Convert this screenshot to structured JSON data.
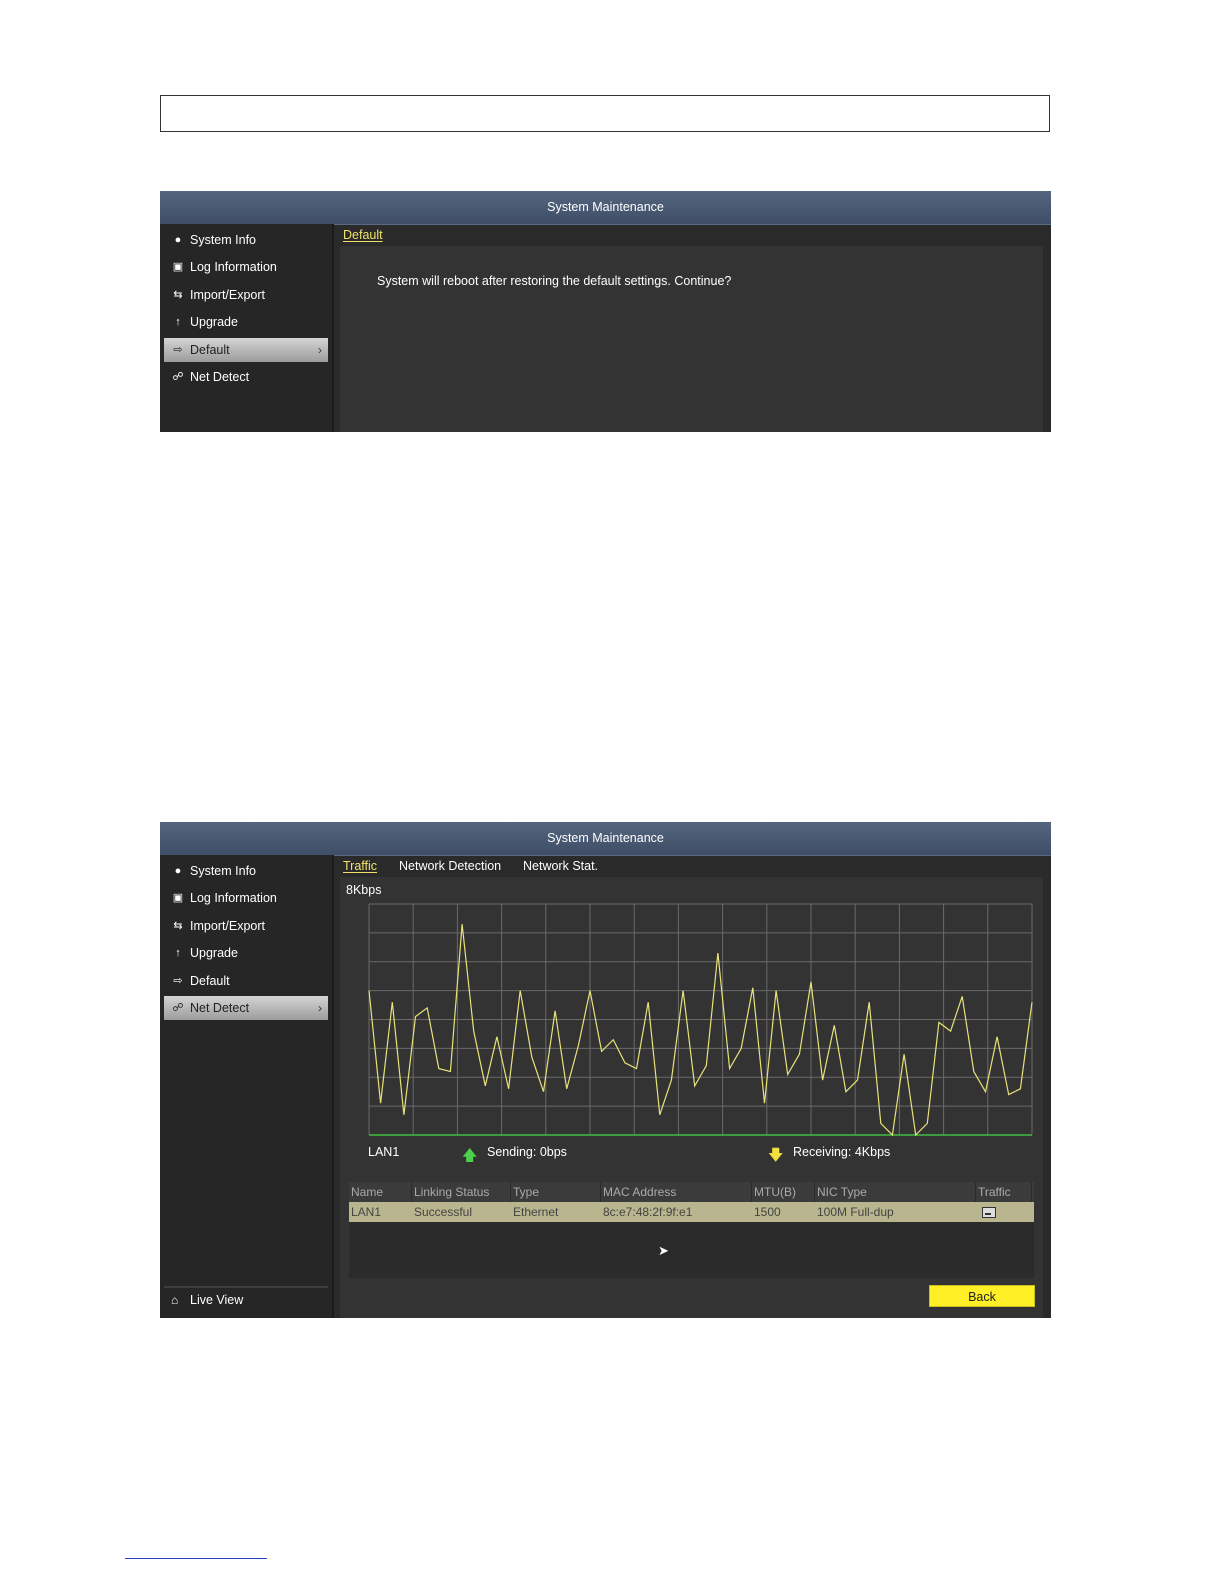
{
  "panel1": {
    "title": "System Maintenance",
    "menu": [
      {
        "label": "System Info",
        "icon": "info-icon"
      },
      {
        "label": "Log Information",
        "icon": "log-icon"
      },
      {
        "label": "Import/Export",
        "icon": "import-export-icon"
      },
      {
        "label": "Upgrade",
        "icon": "upgrade-icon"
      },
      {
        "label": "Default",
        "icon": "default-icon",
        "active": true
      },
      {
        "label": "Net Detect",
        "icon": "net-detect-icon"
      }
    ],
    "tab": "Default",
    "message": "System will reboot after restoring the default settings. Continue?"
  },
  "panel2": {
    "title": "System Maintenance",
    "menu": [
      {
        "label": "System Info",
        "icon": "info-icon"
      },
      {
        "label": "Log Information",
        "icon": "log-icon"
      },
      {
        "label": "Import/Export",
        "icon": "import-export-icon"
      },
      {
        "label": "Upgrade",
        "icon": "upgrade-icon"
      },
      {
        "label": "Default",
        "icon": "default-icon"
      },
      {
        "label": "Net Detect",
        "icon": "net-detect-icon",
        "active": true
      }
    ],
    "live_view": "Live View",
    "tabs": [
      "Traffic",
      "Network Detection",
      "Network Stat."
    ],
    "graph": {
      "ymax_label": "8Kbps",
      "lan_label": "LAN1",
      "sending": "Sending: 0bps",
      "receiving": "Receiving: 4Kbps"
    },
    "table": {
      "headers": [
        "Name",
        "Linking Status",
        "Type",
        "MAC Address",
        "MTU(B)",
        "NIC Type",
        "Traffic"
      ],
      "row": [
        "LAN1",
        "Successful",
        "Ethernet",
        "8c:e7:48:2f:9f:e1",
        "1500",
        "100M Full-dup"
      ]
    },
    "back_label": "Back"
  },
  "chart_data": {
    "type": "line",
    "ylabel": "8Kbps",
    "ylim": [
      0,
      8
    ],
    "grid": true,
    "series": [
      {
        "name": "LAN1",
        "values": [
          5.0,
          1.1,
          4.6,
          0.7,
          4.1,
          4.4,
          2.3,
          2.2,
          7.3,
          3.6,
          1.7,
          3.4,
          1.6,
          5.0,
          2.7,
          1.5,
          4.3,
          1.6,
          3.1,
          5.0,
          2.9,
          3.3,
          2.5,
          2.3,
          4.6,
          0.7,
          1.9,
          5.0,
          1.7,
          2.4,
          6.3,
          2.3,
          3.0,
          5.1,
          1.1,
          5.0,
          2.1,
          2.8,
          5.3,
          1.9,
          3.8,
          1.5,
          1.9,
          4.6,
          0.4,
          0.0,
          2.8,
          0.0,
          0.4,
          3.9,
          3.6,
          4.8,
          2.2,
          1.5,
          3.4,
          1.4,
          1.6,
          4.6
        ]
      }
    ]
  }
}
